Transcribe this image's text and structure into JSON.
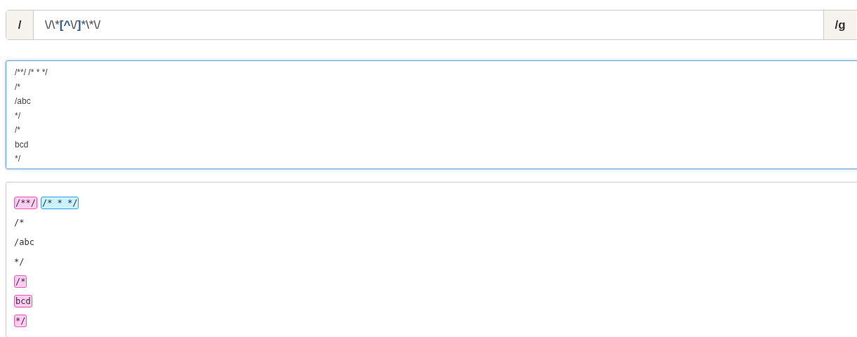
{
  "regex_bar": {
    "prefix": "/",
    "pattern": [
      {
        "text": "\\/\\*",
        "kind": "plain"
      },
      {
        "text": "[^",
        "kind": "bracket"
      },
      {
        "text": "\\/",
        "kind": "plain"
      },
      {
        "text": "]",
        "kind": "bracket"
      },
      {
        "text": "*\\*\\/",
        "kind": "plain"
      }
    ],
    "flags": "/g"
  },
  "test_text": {
    "focused": true,
    "lines": [
      "/**/ /* * */",
      "/*",
      "/abc",
      "*/",
      "/*",
      "bcd",
      "*/"
    ]
  },
  "result_lines": [
    [
      {
        "text": "/**/",
        "match": true,
        "color": "#ffccf2"
      },
      {
        "text": "/* * */",
        "match": true,
        "color": "#c9f2fc"
      }
    ],
    [
      {
        "text": "/*",
        "match": false
      }
    ],
    [
      {
        "text": "/abc",
        "match": false
      }
    ],
    [
      {
        "text": "*/",
        "match": false
      }
    ],
    [
      {
        "text": "/*",
        "match": true,
        "color": "#ffccf2"
      }
    ],
    [
      {
        "text": "bcd",
        "match": true,
        "color": "#ffccf2"
      }
    ],
    [
      {
        "text": "*/",
        "match": true,
        "color": "#ffccf2"
      }
    ]
  ]
}
